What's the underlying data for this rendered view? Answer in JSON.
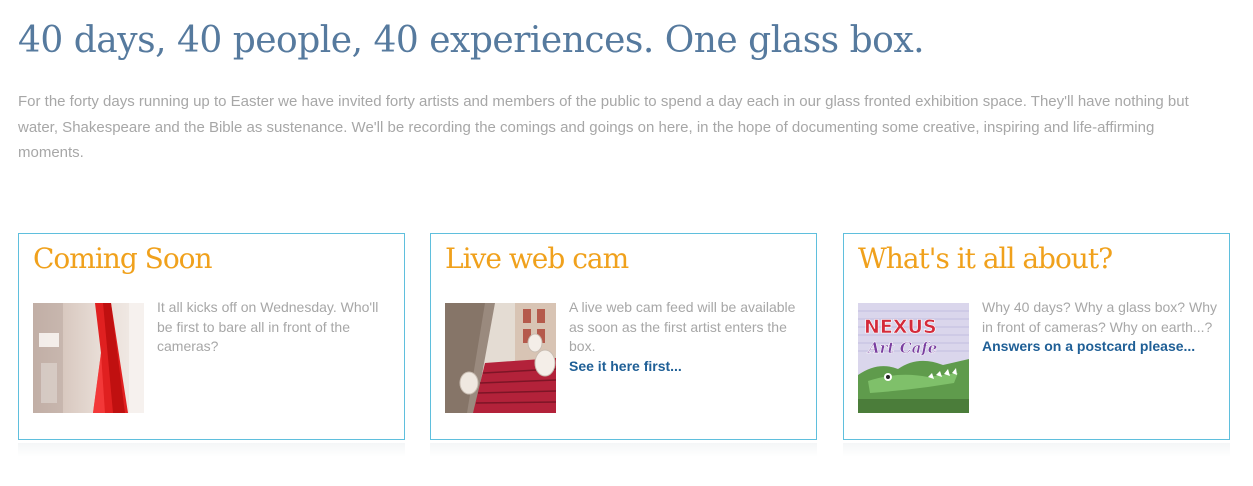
{
  "header": {
    "headline": "40 days, 40 people, 40 experiences. One glass box.",
    "intro": "For the forty days running up to Easter we have invited forty artists and members of the public to spend a day each in our glass fronted exhibition space. They'll have nothing but water, Shakespeare and the Bible as sustenance. We'll be recording the comings and goings on here, in the hope of documenting some creative, inspiring and life-affirming moments."
  },
  "cards": [
    {
      "title": "Coming Soon",
      "body": "It all kicks off on Wednesday. Who'll be first to bare all in front of the cameras?",
      "link": ""
    },
    {
      "title": "Live web cam",
      "body": "A live web cam feed will be available as soon as the first artist enters the box.",
      "link": "See it here first..."
    },
    {
      "title": "What's it all about?",
      "body": "Why 40 days? Why a glass box? Why in front of cameras? Why on earth...?",
      "link": "Answers on a postcard please...",
      "image_text": {
        "line1": "NEXUS",
        "line2": "Art Cafe"
      }
    }
  ],
  "colors": {
    "headline": "#567a9e",
    "intro_text": "#a7a7a7",
    "card_title": "#f0a11c",
    "card_border": "#5fbfdd",
    "link": "#1f5f96"
  }
}
